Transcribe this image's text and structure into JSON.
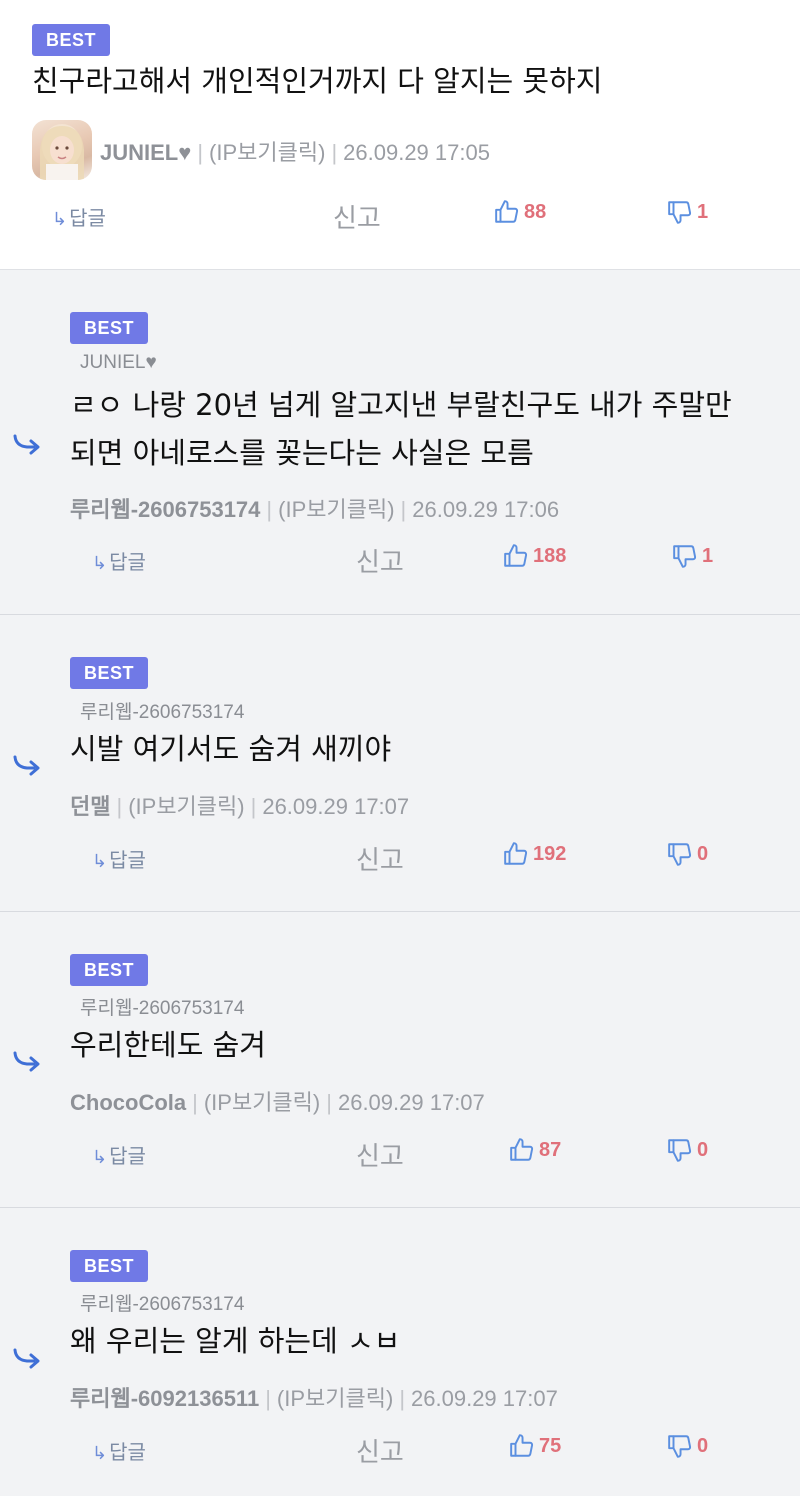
{
  "comments": [
    {
      "badge": "BEST",
      "text": "친구라고해서 개인적인거까지 다 알지는 못하지",
      "nick": "JUNIEL♥",
      "ip": "(IP보기클릭)",
      "date": "26.09.29 17:05",
      "reply_label": "답글",
      "report_label": "신고",
      "likes": "88",
      "dislikes": "1"
    },
    {
      "badge": "BEST",
      "parent_nick": "JUNIEL♥",
      "text_line1": "ㄹㅇ 나랑 20년 넘게 알고지낸 부랄친구도 내가 주말만",
      "text_line2": "되면 아네로스를 꽂는다는 사실은 모름",
      "nick": "루리웹-2606753174",
      "ip": "(IP보기클릭)",
      "date": "26.09.29 17:06",
      "reply_label": "답글",
      "report_label": "신고",
      "likes": "188",
      "dislikes": "1"
    },
    {
      "badge": "BEST",
      "parent_nick": "루리웹-2606753174",
      "text": "시발 여기서도 숨겨 새끼야",
      "nick": "던맬",
      "ip": "(IP보기클릭)",
      "date": "26.09.29 17:07",
      "reply_label": "답글",
      "report_label": "신고",
      "likes": "192",
      "dislikes": "0"
    },
    {
      "badge": "BEST",
      "parent_nick": "루리웹-2606753174",
      "text": "우리한테도 숨겨",
      "nick": "ChocoCola",
      "ip": "(IP보기클릭)",
      "date": "26.09.29 17:07",
      "reply_label": "답글",
      "report_label": "신고",
      "likes": "87",
      "dislikes": "0"
    },
    {
      "badge": "BEST",
      "parent_nick": "루리웹-2606753174",
      "text": "왜 우리는 알게 하는데 ㅅㅂ",
      "nick": "루리웹-6092136511",
      "ip": "(IP보기클릭)",
      "date": "26.09.29 17:07",
      "reply_label": "답글",
      "report_label": "신고",
      "likes": "75",
      "dislikes": "0"
    }
  ],
  "icons": {
    "like": "thumbs-up-icon",
    "dislike": "thumbs-down-icon",
    "reply_arrow": "reply-arrow-icon",
    "indent": "indent-arrow-icon"
  },
  "colors": {
    "badge": "#7079e6",
    "counts": "#e0707a",
    "icon": "#5b8fe0"
  }
}
